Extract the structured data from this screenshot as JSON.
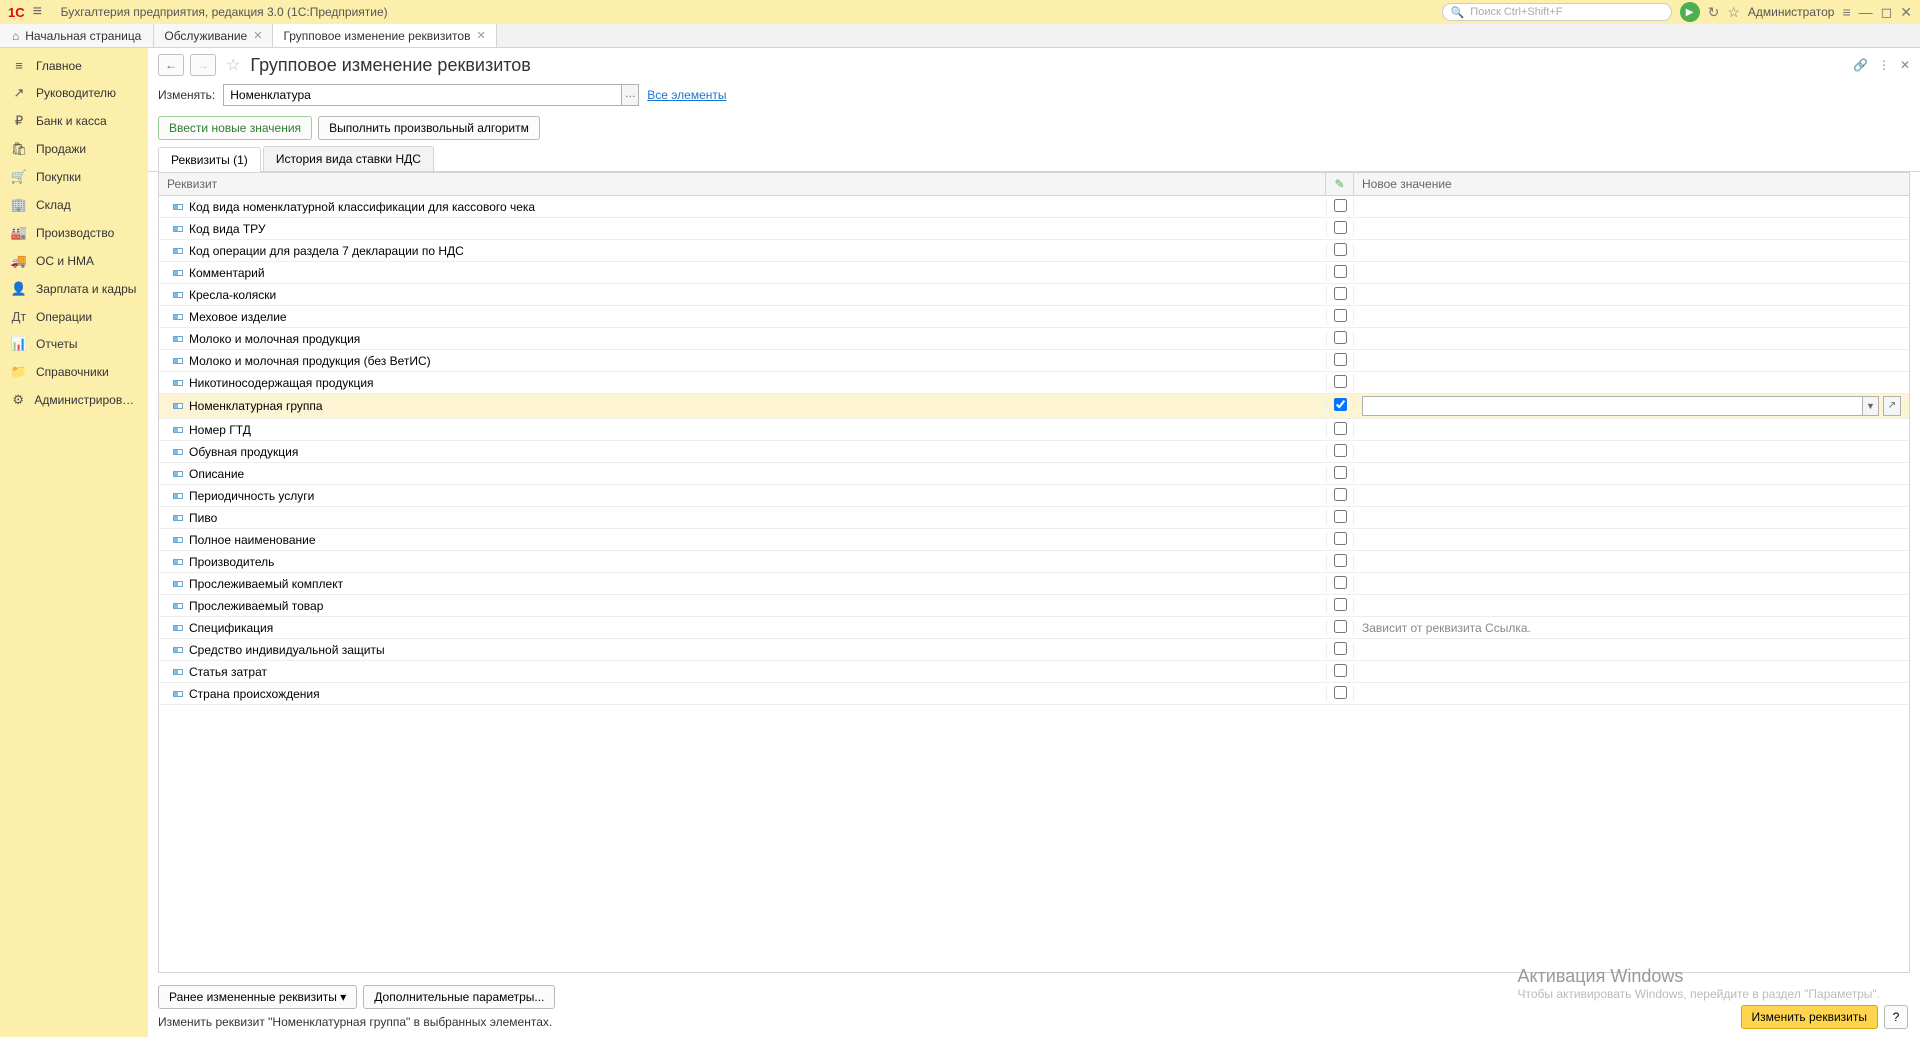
{
  "titlebar": {
    "logo": "1C",
    "title": "Бухгалтерия предприятия, редакция 3.0  (1С:Предприятие)",
    "search_placeholder": "Поиск Ctrl+Shift+F",
    "admin": "Администратор"
  },
  "tabs": {
    "home": "Начальная страница",
    "items": [
      {
        "label": "Обслуживание",
        "active": false
      },
      {
        "label": "Групповое изменение реквизитов",
        "active": true
      }
    ]
  },
  "sidebar": {
    "items": [
      {
        "icon": "≡",
        "label": "Главное"
      },
      {
        "icon": "↗",
        "label": "Руководителю"
      },
      {
        "icon": "₽",
        "label": "Банк и касса"
      },
      {
        "icon": "🛍",
        "label": "Продажи"
      },
      {
        "icon": "🛒",
        "label": "Покупки"
      },
      {
        "icon": "🏢",
        "label": "Склад"
      },
      {
        "icon": "🏭",
        "label": "Производство"
      },
      {
        "icon": "🚚",
        "label": "ОС и НМА"
      },
      {
        "icon": "👤",
        "label": "Зарплата и кадры"
      },
      {
        "icon": "Дт",
        "label": "Операции"
      },
      {
        "icon": "📊",
        "label": "Отчеты"
      },
      {
        "icon": "📁",
        "label": "Справочники"
      },
      {
        "icon": "⚙",
        "label": "Администрирование"
      }
    ]
  },
  "page": {
    "title": "Групповое изменение реквизитов",
    "change_label": "Изменять:",
    "change_value": "Номенклатура",
    "all_elements": "Все элементы",
    "btn_new_values": "Ввести новые значения",
    "btn_algorithm": "Выполнить произвольный алгоритм",
    "innertabs": [
      {
        "label": "Реквизиты (1)",
        "active": true
      },
      {
        "label": "История вида ставки НДС",
        "active": false
      }
    ]
  },
  "table": {
    "header_name": "Реквизит",
    "header_value": "Новое значение",
    "rows": [
      {
        "name": "Код вида номенклатурной классификации для кассового чека",
        "checked": false,
        "value": ""
      },
      {
        "name": "Код вида ТРУ",
        "checked": false,
        "value": ""
      },
      {
        "name": "Код операции для раздела 7 декларации по НДС",
        "checked": false,
        "value": ""
      },
      {
        "name": "Комментарий",
        "checked": false,
        "value": ""
      },
      {
        "name": "Кресла-коляски",
        "checked": false,
        "value": ""
      },
      {
        "name": "Меховое изделие",
        "checked": false,
        "value": ""
      },
      {
        "name": "Молоко и молочная продукция",
        "checked": false,
        "value": ""
      },
      {
        "name": "Молоко и молочная продукция (без ВетИС)",
        "checked": false,
        "value": ""
      },
      {
        "name": "Никотиносодержащая продукция",
        "checked": false,
        "value": ""
      },
      {
        "name": "Номенклатурная группа",
        "checked": true,
        "value": "",
        "selected": true,
        "editable": true
      },
      {
        "name": "Номер ГТД",
        "checked": false,
        "value": ""
      },
      {
        "name": "Обувная продукция",
        "checked": false,
        "value": ""
      },
      {
        "name": "Описание",
        "checked": false,
        "value": ""
      },
      {
        "name": "Периодичность услуги",
        "checked": false,
        "value": ""
      },
      {
        "name": "Пиво",
        "checked": false,
        "value": ""
      },
      {
        "name": "Полное наименование",
        "checked": false,
        "value": ""
      },
      {
        "name": "Производитель",
        "checked": false,
        "value": ""
      },
      {
        "name": "Прослеживаемый комплект",
        "checked": false,
        "value": ""
      },
      {
        "name": "Прослеживаемый товар",
        "checked": false,
        "value": ""
      },
      {
        "name": "Спецификация",
        "checked": false,
        "value": "Зависит от реквизита Ссылка."
      },
      {
        "name": "Средство индивидуальной защиты",
        "checked": false,
        "value": ""
      },
      {
        "name": "Статья затрат",
        "checked": false,
        "value": ""
      },
      {
        "name": "Страна происхождения",
        "checked": false,
        "value": ""
      }
    ]
  },
  "footer": {
    "btn_prev": "Ранее измененные реквизиты",
    "btn_more": "Дополнительные параметры...",
    "message": "Изменить реквизит \"Номенклатурная группа\" в выбранных элементах.",
    "btn_apply": "Изменить реквизиты",
    "btn_help": "?"
  },
  "watermark": {
    "title": "Активация Windows",
    "sub": "Чтобы активировать Windows, перейдите в раздел \"Параметры\"."
  }
}
